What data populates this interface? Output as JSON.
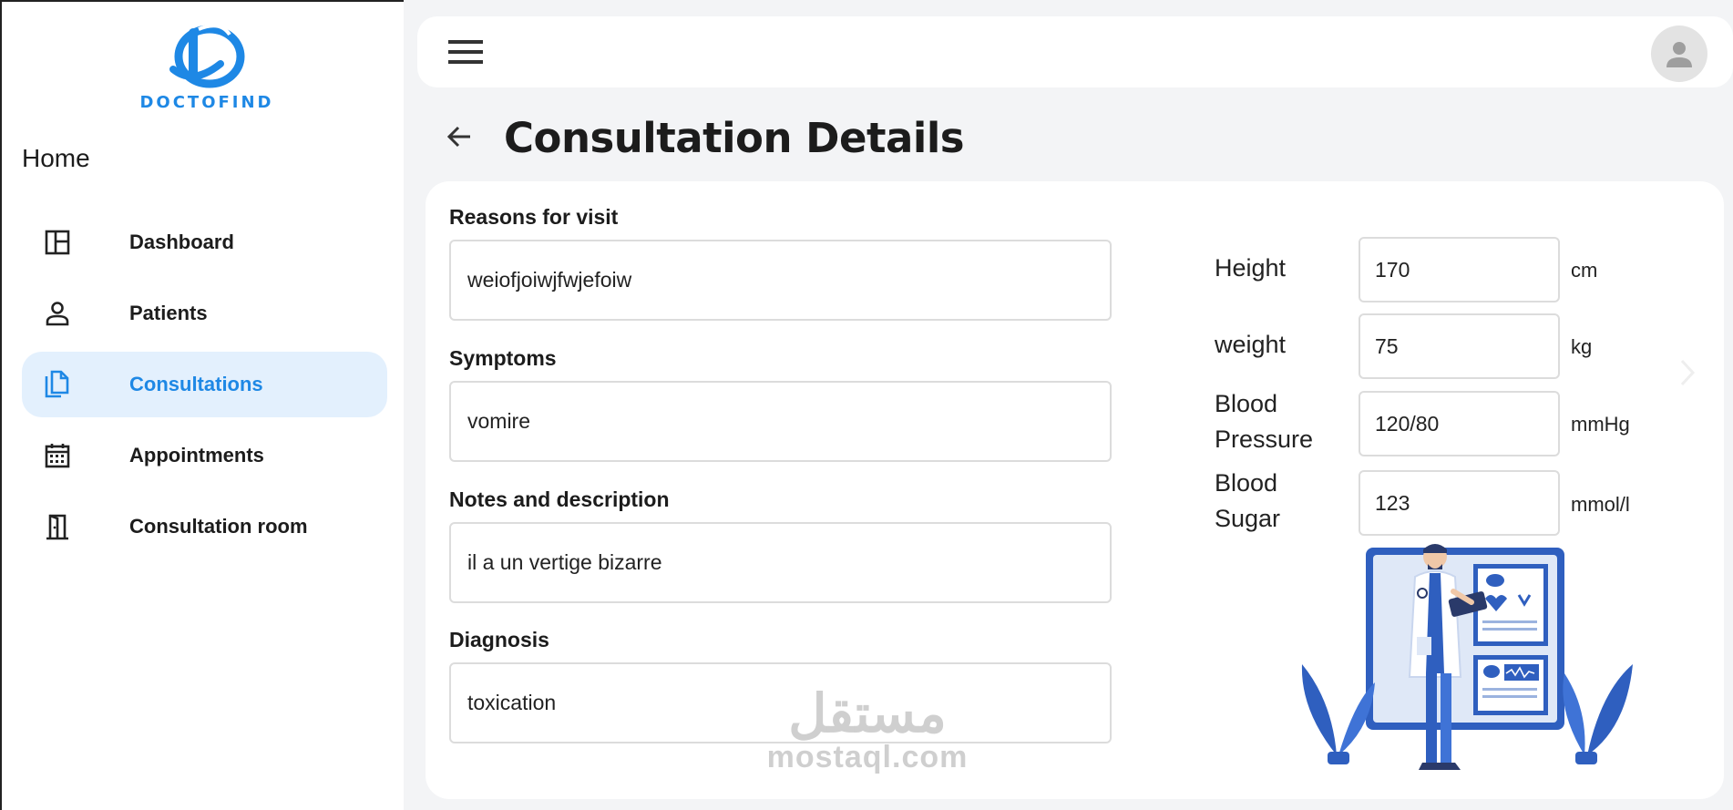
{
  "app": {
    "logo_text": "DOCTOFIND",
    "brand_color": "#1e88e5"
  },
  "sidebar": {
    "title": "Home",
    "items": [
      {
        "label": "Dashboard",
        "icon": "dashboard-icon",
        "active": false
      },
      {
        "label": "Patients",
        "icon": "person-icon",
        "active": false
      },
      {
        "label": "Consultations",
        "icon": "copy-icon",
        "active": true
      },
      {
        "label": "Appointments",
        "icon": "calendar-icon",
        "active": false
      },
      {
        "label": "Consultation room",
        "icon": "door-icon",
        "active": false
      }
    ]
  },
  "topbar": {
    "menu_icon": "hamburger-menu-icon",
    "avatar_icon": "user-avatar-icon"
  },
  "page": {
    "title": "Consultation Details",
    "back_icon": "arrow-left-icon"
  },
  "form": {
    "fields": [
      {
        "label": "Reasons for visit",
        "value": "weiofjoiwjfwjefoiw"
      },
      {
        "label": "Symptoms",
        "value": "vomire"
      },
      {
        "label": "Notes and description",
        "value": "il a un vertige bizarre"
      },
      {
        "label": "Diagnosis",
        "value": "toxication"
      }
    ]
  },
  "vitals": [
    {
      "label": "Height",
      "value": "170",
      "unit": "cm"
    },
    {
      "label": "weight",
      "value": "75",
      "unit": "kg"
    },
    {
      "label": "Blood Pressure",
      "value": "120/80",
      "unit": "mmHg"
    },
    {
      "label": "Blood Sugar",
      "value": "123",
      "unit": "mmol/l"
    }
  ],
  "watermark": {
    "arabic": "مستقل",
    "latin": "mostaql.com"
  }
}
